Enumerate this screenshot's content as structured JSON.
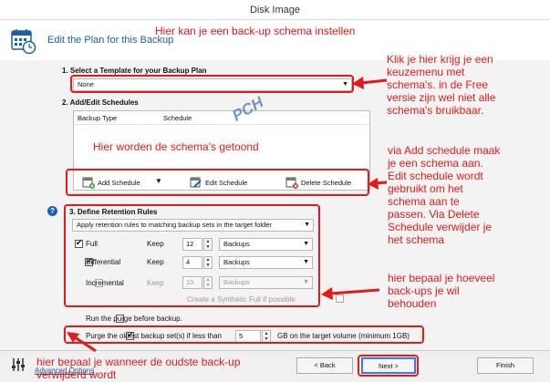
{
  "window": {
    "title": "Disk Image"
  },
  "header": {
    "title": "Edit the Plan for this Backup"
  },
  "section1": {
    "label": "1. Select a Template for your Backup Plan",
    "template_value": "None"
  },
  "section2": {
    "label": "2. Add/Edit Schedules",
    "columns": [
      "Backup Type",
      "Schedule"
    ],
    "buttons": {
      "add": "Add Schedule",
      "edit": "Edit Schedule",
      "delete": "Delete Schedule"
    }
  },
  "watermark": "PCH",
  "section3": {
    "label": "3. Define Retention Rules",
    "rule_mode": "Apply retention rules to matching backup sets in the target folder",
    "rows": [
      {
        "name": "Full",
        "checked": true,
        "keep_label": "Keep",
        "keep_value": "12",
        "unit": "Backups",
        "enabled": true
      },
      {
        "name": "Differential",
        "checked": true,
        "keep_label": "Keep",
        "keep_value": "4",
        "unit": "Backups",
        "enabled": true
      },
      {
        "name": "Incremental",
        "checked": false,
        "keep_label": "Keep",
        "keep_value": "10",
        "unit": "Backups",
        "enabled": false
      }
    ],
    "synthetic_label": "Create a Synthetic Full if possible",
    "purge_before_label": "Run the purge before backup.",
    "purge_oldest_label": "Purge the oldest backup set(s) if less than",
    "purge_value": "5",
    "purge_suffix": "GB on the target volume (minimum 1GB)"
  },
  "footer": {
    "advanced_label": "Advanced Options",
    "back_label": "< Back",
    "next_label": "Next >",
    "finish_label": "Finish"
  },
  "annotations": {
    "a1": "Hier kan je een back-up schema instellen",
    "a2": [
      "Klik je hier krijg je een",
      "keuzemenu met",
      "schema's. in de Free",
      "versie zijn wel niet alle",
      "schema's bruikbaar."
    ],
    "a3": "Hier worden de schema's getoond",
    "a4": [
      "via Add schedule maak",
      "je een schema aan.",
      "Edit schedule wordt",
      "gebruikt om het",
      "schema aan te",
      "passen. Via Delete",
      "Schedule verwijder je",
      "het schema"
    ],
    "a5": [
      "hier bepaal je hoeveel",
      "back-ups je wil",
      "behouden"
    ],
    "a6": [
      "hier bepaal je wanneer de oudste back-up",
      "verwijderd wordt"
    ]
  },
  "colors": {
    "annotation": "#e51919",
    "title": "#1c5fa8",
    "info": "#1d5fb6"
  }
}
